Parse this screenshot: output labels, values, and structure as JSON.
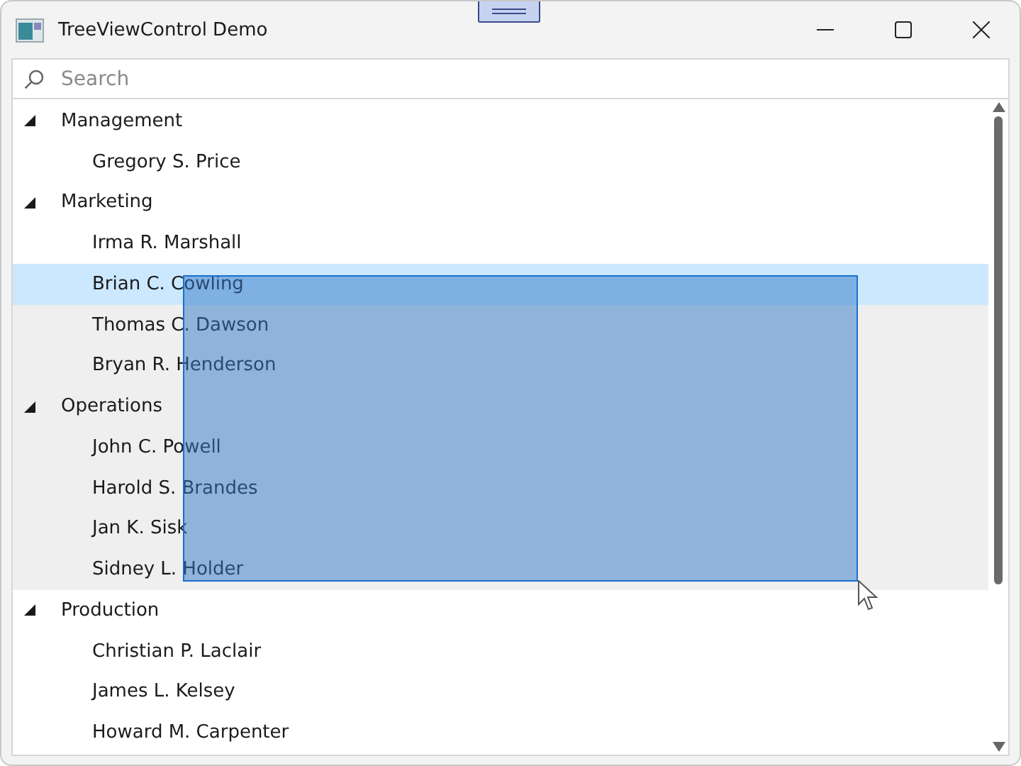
{
  "window": {
    "title": "TreeViewControl Demo"
  },
  "search": {
    "placeholder": "Search"
  },
  "tree": [
    {
      "label": "Management",
      "expanded": true,
      "marked": false,
      "children": [
        {
          "label": "Gregory S. Price",
          "selected": false,
          "marked": false
        }
      ]
    },
    {
      "label": "Marketing",
      "expanded": true,
      "marked": false,
      "children": [
        {
          "label": "Irma R. Marshall",
          "selected": false,
          "marked": false
        },
        {
          "label": "Brian C. Cowling",
          "selected": true,
          "marked": false
        },
        {
          "label": "Thomas C. Dawson",
          "selected": false,
          "marked": true
        },
        {
          "label": "Bryan R. Henderson",
          "selected": false,
          "marked": true
        }
      ]
    },
    {
      "label": "Operations",
      "expanded": true,
      "marked": true,
      "children": [
        {
          "label": "John C. Powell",
          "selected": false,
          "marked": true
        },
        {
          "label": "Harold S. Brandes",
          "selected": false,
          "marked": true
        },
        {
          "label": "Jan K. Sisk",
          "selected": false,
          "marked": true
        },
        {
          "label": "Sidney L. Holder",
          "selected": false,
          "marked": true
        }
      ]
    },
    {
      "label": "Production",
      "expanded": true,
      "marked": false,
      "children": [
        {
          "label": "Christian P. Laclair",
          "selected": false,
          "marked": false
        },
        {
          "label": "James L. Kelsey",
          "selected": false,
          "marked": false
        },
        {
          "label": "Howard M. Carpenter",
          "selected": false,
          "marked": false
        }
      ]
    }
  ]
}
